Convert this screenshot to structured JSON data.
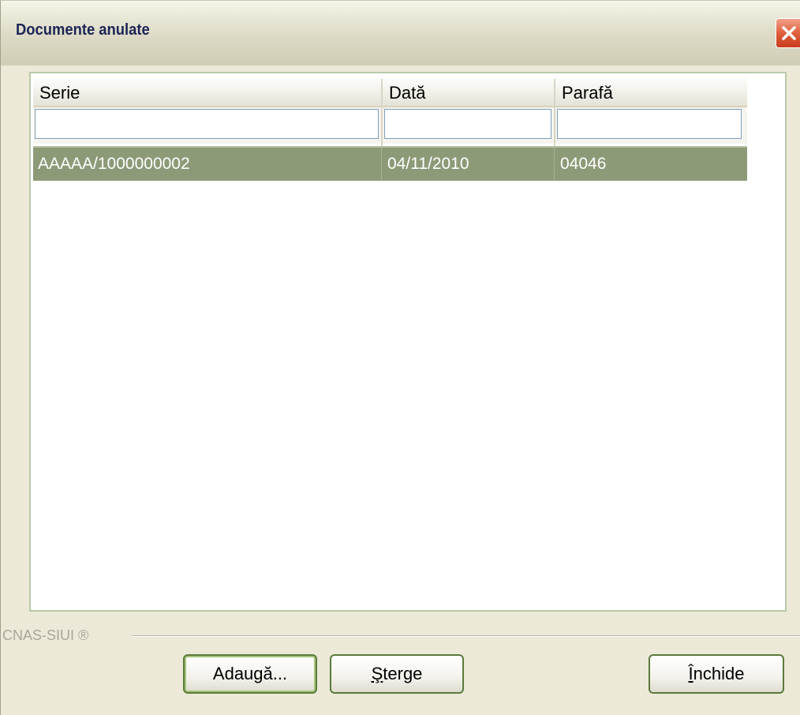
{
  "window": {
    "title": "Documente anulate"
  },
  "table": {
    "columns": [
      {
        "label": "Serie"
      },
      {
        "label": "Dată"
      },
      {
        "label": "Parafă"
      }
    ],
    "filters": [
      "",
      "",
      ""
    ],
    "rows": [
      {
        "serie": "AAAAA/1000000002",
        "data": "04/11/2010",
        "parafa": "04046",
        "selected": true
      }
    ]
  },
  "footer": {
    "label": "CNAS-SIUI ®"
  },
  "buttons": {
    "add": "Adaugă...",
    "delete_prefix": "Ş",
    "delete_rest": "terge",
    "close_prefix": "Î",
    "close_rest": "nchide"
  },
  "colors": {
    "selected_row": "#8d9a78",
    "title_text": "#1c2456",
    "close_button": "#e0603c"
  },
  "icons": {
    "close": "close-icon"
  }
}
